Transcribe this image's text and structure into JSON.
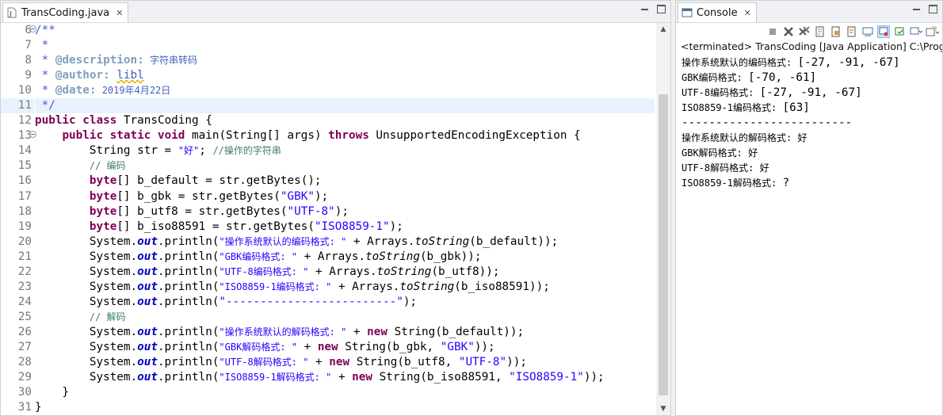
{
  "editor": {
    "tab_label": "TransCoding.java",
    "close_glyph": "✕",
    "line_numbers": [
      "6",
      "7",
      "8",
      "9",
      "10",
      "11",
      "12",
      "13",
      "14",
      "15",
      "16",
      "17",
      "18",
      "19",
      "20",
      "21",
      "22",
      "23",
      "24",
      "25",
      "26",
      "27",
      "28",
      "29",
      "30",
      "31"
    ],
    "code": {
      "l6": "/**",
      "l7": " *",
      "l8_star": " * ",
      "l8_tag": "@description:",
      "l8_text": " 字符串转码",
      "l9_star": " * ",
      "l9_tag": "@author:",
      "l9_sp": " ",
      "l9_text": "libl",
      "l10_star": " * ",
      "l10_tag": "@date:",
      "l10_text": " 2019年4月22日",
      "l11": " */",
      "kw_public": "public",
      "kw_class": "class",
      "kw_static": "static",
      "kw_void": "void",
      "kw_throws": "throws",
      "kw_byte": "byte",
      "kw_new": "new",
      "class_name": " TransCoding {",
      "main_sig": " main(String[] args) ",
      "exception": " UnsupportedEncodingException {",
      "l14_pre": "        String str = ",
      "l14_str": "\"好\"",
      "l14_semi": "; ",
      "l14_cm": "//操作的字符串",
      "l15_cm": "// 编码",
      "l16_rest": "[] b_default = str.getBytes();",
      "l17_rest": "[] b_gbk = str.getBytes(",
      "str_gbk": "\"GBK\"",
      "close_stmt": ");",
      "l18_rest": "[] b_utf8 = str.getBytes(",
      "str_utf8": "\"UTF-8\"",
      "l19_rest": "[] b_iso88591 = str.getBytes(",
      "str_iso": "\"ISO8859-1\"",
      "sys": "        System.",
      "out": "out",
      "println": ".println(",
      "s20": "\"操作系统默认的编码格式: \"",
      "s21": "\"GBK编码格式: \"",
      "s22": "\"UTF-8编码格式: \"",
      "s23": "\"ISO8859-1编码格式: \"",
      "s24": "\"-------------------------\"",
      "s26": "\"操作系统默认的解码格式: \"",
      "s27": "\"GBK解码格式: \"",
      "s28": "\"UTF-8解码格式: \"",
      "s29": "\"ISO8859-1解码格式: \"",
      "plus_arrays": " + Arrays.",
      "tostring": "toString",
      "a20": "(b_default));",
      "a21": "(b_gbk));",
      "a22": "(b_utf8));",
      "a23": "(b_iso88591));",
      "l25_cm": "// 解码",
      "plus": " + ",
      "n26": " String(b_default));",
      "n27": " String(b_gbk, ",
      "n28": " String(b_utf8, ",
      "n29": " String(b_iso88591, ",
      "end_call": "));",
      "l30": "    }",
      "l31": "}"
    }
  },
  "console": {
    "tab_label": "Console",
    "close_glyph": "✕",
    "terminated": "<terminated> TransCoding [Java Application] C:\\Program",
    "output": [
      {
        "label": "操作系统默认的编码格式: ",
        "value": "[-27, -91, -67]"
      },
      {
        "label": "GBK编码格式: ",
        "value": "[-70, -61]"
      },
      {
        "label": "UTF-8编码格式: ",
        "value": "[-27, -91, -67]"
      },
      {
        "label": "ISO8859-1编码格式: ",
        "value": "[63]"
      },
      {
        "label": "",
        "value": "-------------------------"
      },
      {
        "label": "操作系统默认的解码格式: ",
        "value": "好"
      },
      {
        "label": "GBK解码格式: ",
        "value": "好"
      },
      {
        "label": "UTF-8解码格式: ",
        "value": "好"
      },
      {
        "label": "ISO8859-1解码格式: ",
        "value": "?"
      }
    ]
  },
  "icons": {
    "java_file": "java-file-icon",
    "console": "console-icon",
    "scroll_up": "▲",
    "scroll_down": "▼"
  },
  "colors": {
    "keyword": "#7f0055",
    "comment": "#3f7f5f",
    "javadoc": "#3f5fbf",
    "string": "#2a00ff",
    "field": "#0000c0",
    "current_line": "#e8f2fe"
  }
}
